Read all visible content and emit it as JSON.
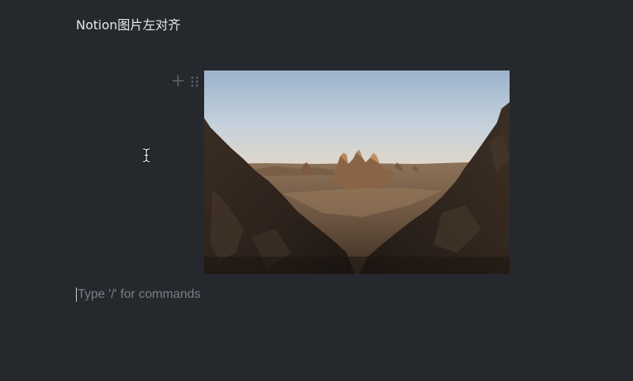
{
  "page": {
    "title": "Notion图片左对齐"
  },
  "block_handles": {
    "add_icon": "plus-icon",
    "drag_icon": "drag-handle-icon"
  },
  "image_block": {
    "description_icon": "landscape-image"
  },
  "editor": {
    "placeholder": "Type '/' for commands"
  },
  "colors": {
    "background": "#25282d",
    "title_text": "#e8e8e8",
    "placeholder_text": "#7b7e84",
    "handle_icon": "#5f6369"
  }
}
